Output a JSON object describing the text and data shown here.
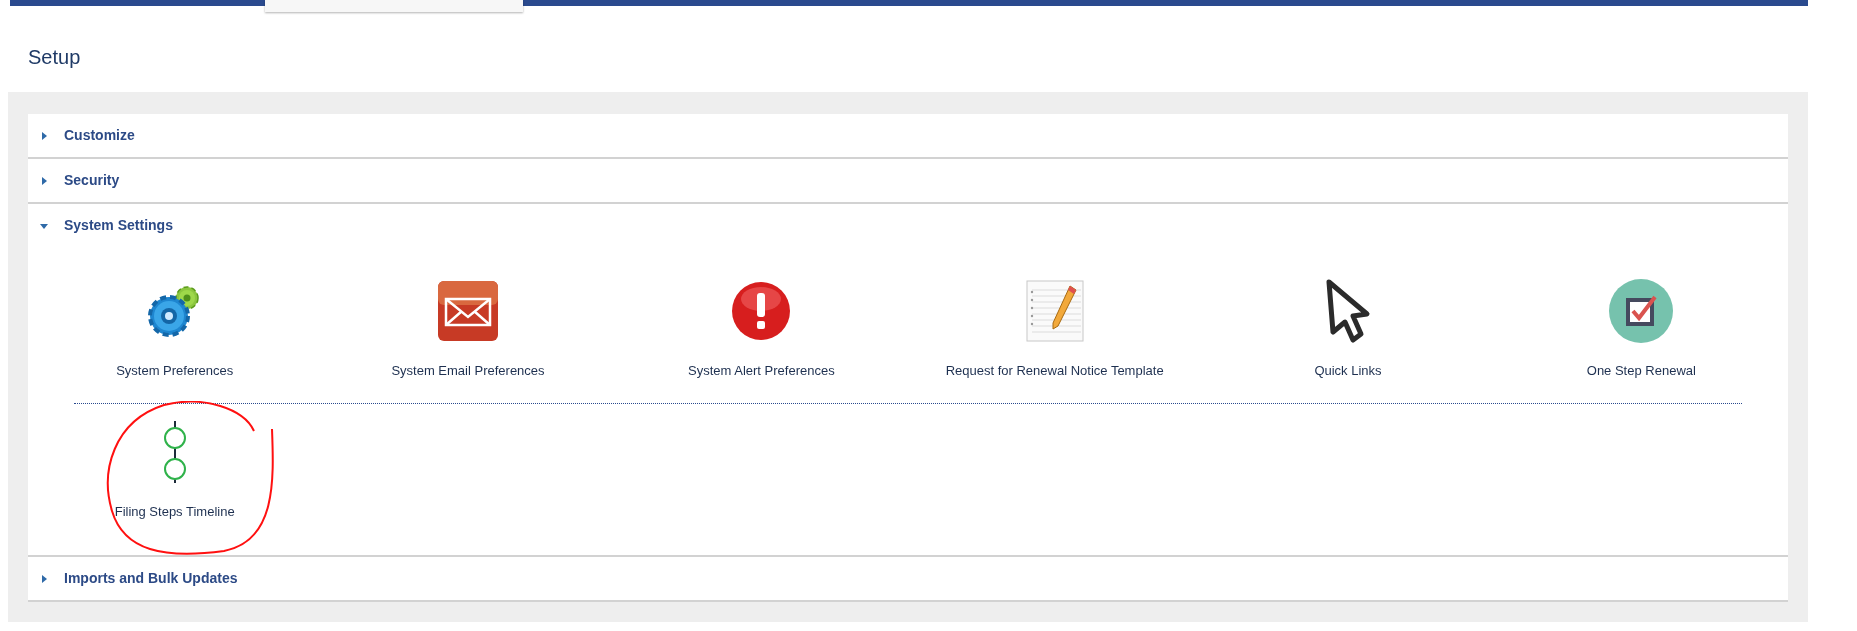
{
  "page": {
    "title": "Setup"
  },
  "sections": [
    {
      "title": "Customize",
      "expanded": false
    },
    {
      "title": "Security",
      "expanded": false
    },
    {
      "title": "System Settings",
      "expanded": true,
      "rows": [
        [
          {
            "label": "System Preferences"
          },
          {
            "label": "System Email Preferences"
          },
          {
            "label": "System Alert Preferences"
          },
          {
            "label": "Request for Renewal Notice Template"
          },
          {
            "label": "Quick Links"
          },
          {
            "label": "One Step Renewal"
          }
        ],
        [
          {
            "label": "Filing Steps Timeline"
          }
        ]
      ]
    },
    {
      "title": "Imports and Bulk Updates",
      "expanded": false
    }
  ]
}
